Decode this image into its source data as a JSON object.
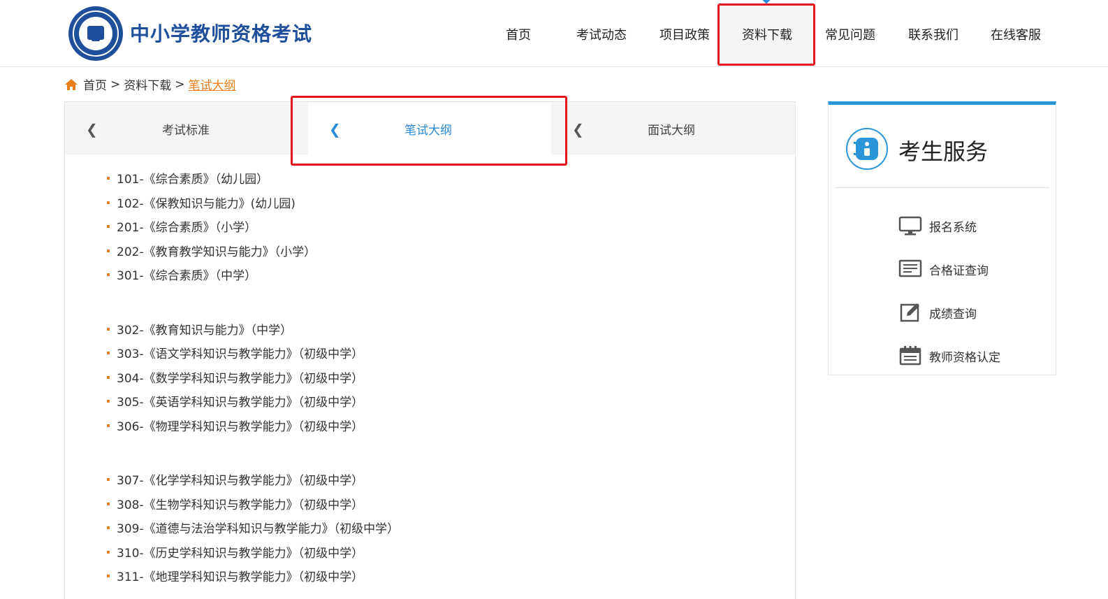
{
  "header": {
    "site_title": "中小学教师资格考试",
    "nav": [
      "首页",
      "考试动态",
      "项目政策",
      "资料下载",
      "常见问题",
      "联系我们",
      "在线客服"
    ],
    "active_nav": "资料下载"
  },
  "breadcrumb": {
    "home": "首页",
    "section": "资料下载",
    "current": "笔试大纲",
    "separator": ">"
  },
  "tabs": [
    {
      "label": "考试标准",
      "active": false
    },
    {
      "label": "笔试大纲",
      "active": true
    },
    {
      "label": "面试大纲",
      "active": false
    }
  ],
  "syllabus_groups": [
    [
      "101-《综合素质》（幼儿园）",
      "102-《保教知识与能力》(幼儿园)",
      "201-《综合素质》（小学）",
      "202-《教育教学知识与能力》（小学）",
      "301-《综合素质》（中学）"
    ],
    [
      "302-《教育知识与能力》（中学）",
      "303-《语文学科知识与教学能力》（初级中学）",
      "304-《数学学科知识与教学能力》（初级中学）",
      "305-《英语学科知识与教学能力》（初级中学）",
      "306-《物理学科知识与教学能力》（初级中学）"
    ],
    [
      "307-《化学学科知识与教学能力》（初级中学）",
      "308-《生物学科知识与教学能力》（初级中学）",
      "309-《道德与法治学科知识与教学能力》（初级中学）",
      "310-《历史学科知识与教学能力》（初级中学）",
      "311-《地理学科知识与教学能力》（初级中学）"
    ]
  ],
  "sidebar": {
    "title": "考生服务",
    "services": [
      {
        "label": "报名系统",
        "icon": "monitor-icon"
      },
      {
        "label": "合格证查询",
        "icon": "certificate-icon"
      },
      {
        "label": "成绩查询",
        "icon": "edit-icon"
      },
      {
        "label": "教师资格认定",
        "icon": "calendar-icon"
      }
    ]
  },
  "colors": {
    "brand_blue": "#1f4f9b",
    "accent_blue": "#2a8ad8",
    "accent_orange": "#e97d18",
    "highlight_red": "#e6141d"
  }
}
